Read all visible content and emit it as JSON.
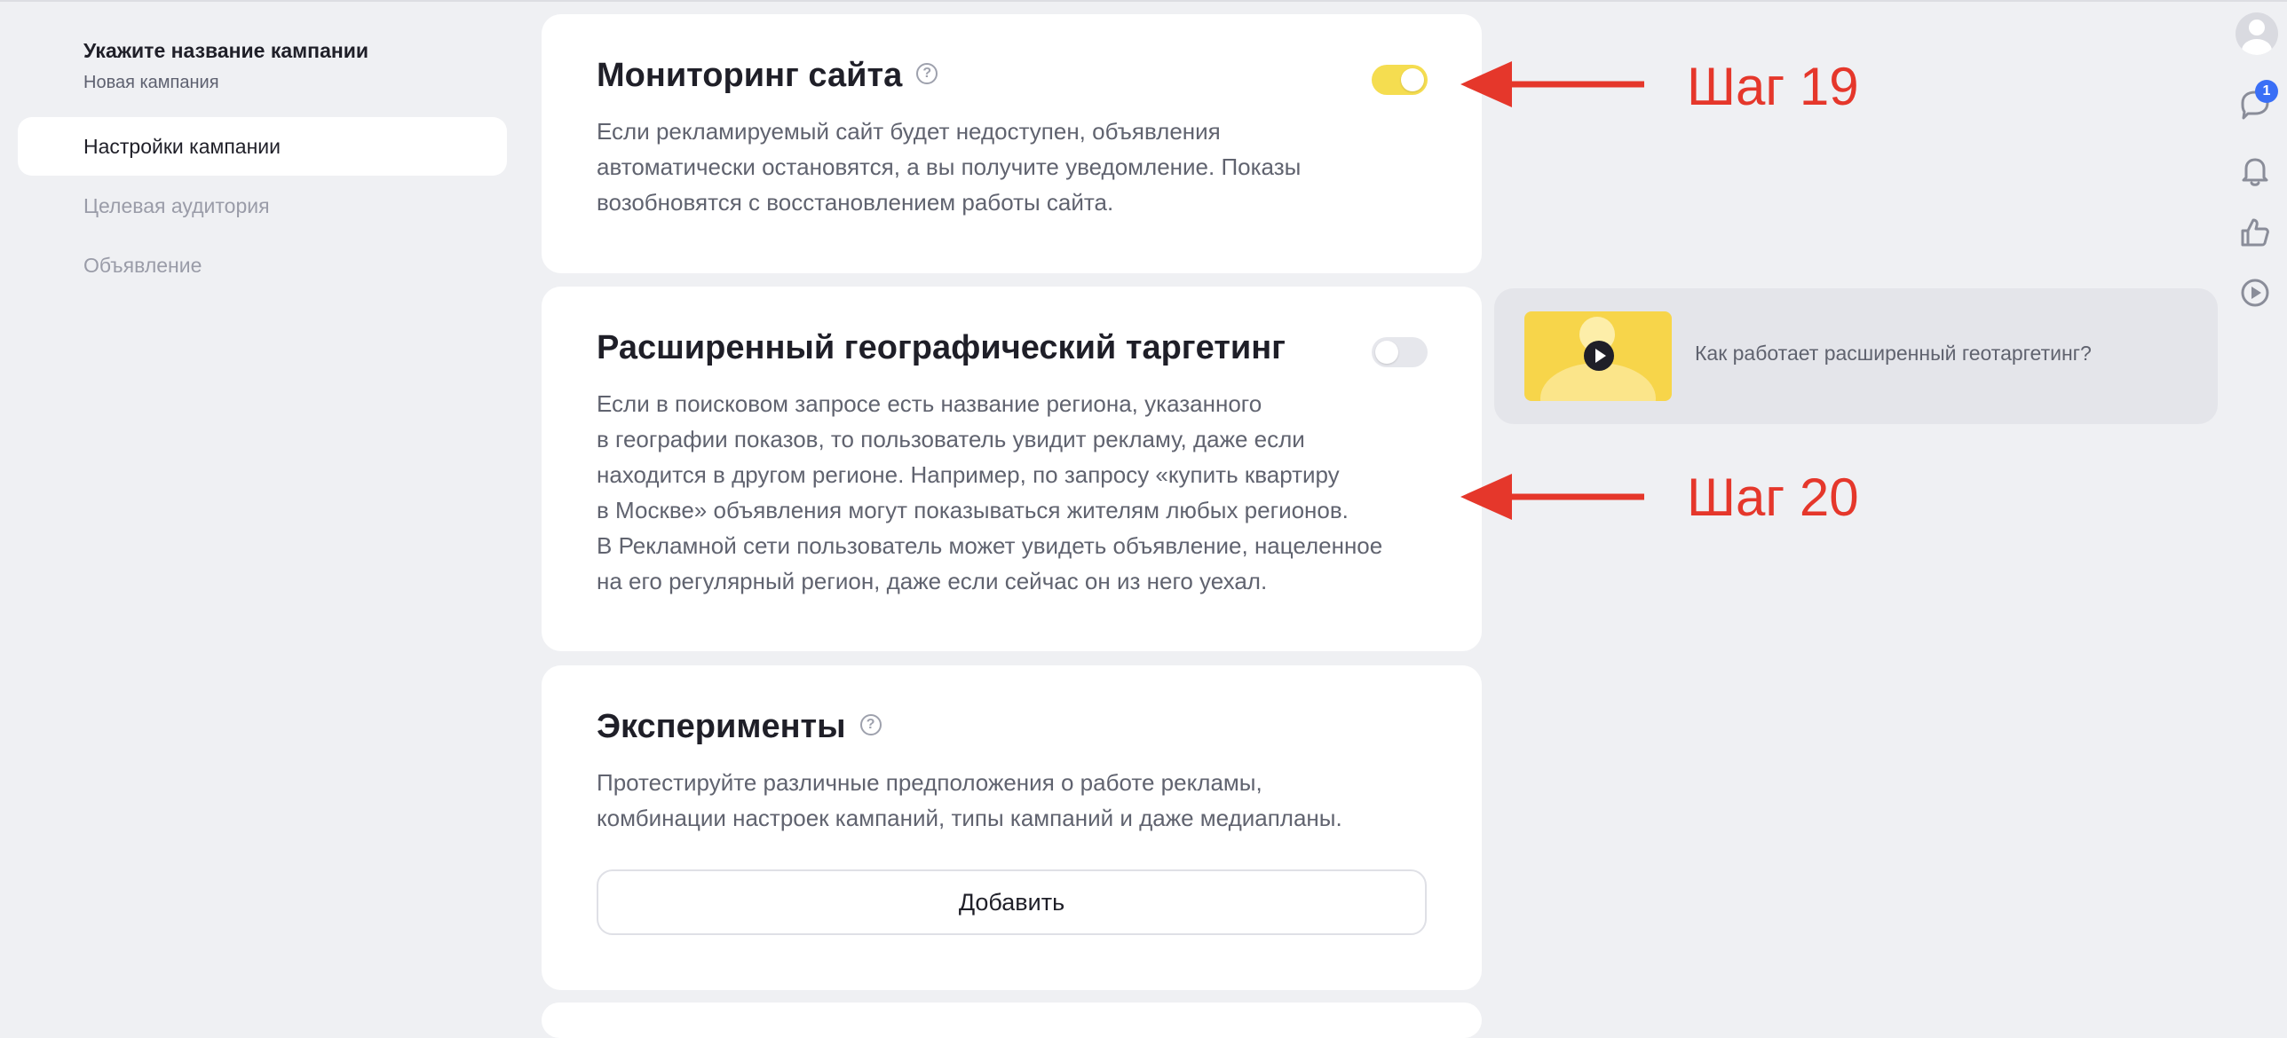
{
  "sidebar": {
    "campaign_title": "Укажите название кампании",
    "campaign_subtitle": "Новая кампания",
    "items": [
      {
        "label": "Настройки кампании",
        "active": true
      },
      {
        "label": "Целевая аудитория",
        "active": false
      },
      {
        "label": "Объявление",
        "active": false
      }
    ]
  },
  "cards": {
    "monitoring": {
      "title": "Мониторинг сайта",
      "help": "?",
      "toggle_on": true,
      "description": "Если рекламируемый сайт будет недоступен, объявления\nавтоматически остановятся, а вы получите уведомление. Показы\nвозобновятся с восстановлением работы сайта."
    },
    "geo": {
      "title": "Расширенный географический таргетинг",
      "toggle_on": false,
      "description": "Если в поисковом запросе есть название региона, указанного\nв географии показов, то пользователь увидит рекламу, даже если\nнаходится в другом регионе. Например, по запросу «купить квартиру\nв Москве» объявления могут показываться жителям любых регионов.\nВ Рекламной сети пользователь может увидеть объявление, нацеленное\nна его регулярный регион, даже если сейчас он из него уехал."
    },
    "experiments": {
      "title": "Эксперименты",
      "help": "?",
      "description": "Протестируйте различные предположения о работе рекламы,\nкомбинации настроек кампаний, типы кампаний и даже медиапланы.",
      "button_label": "Добавить"
    }
  },
  "promo": {
    "text": "Как работает расширенный геотаргетинг?"
  },
  "annotations": {
    "step1": "Шаг 19",
    "step2": "Шаг 20",
    "color": "#e5372b"
  },
  "rail": {
    "chat_badge": "1",
    "icons": [
      "avatar-icon",
      "chat-icon",
      "bell-icon",
      "thumbs-up-icon",
      "play-circle-icon"
    ]
  },
  "colors": {
    "accent_toggle": "#f5dd50",
    "background": "#eff0f3",
    "badge": "#3a6ff6"
  }
}
